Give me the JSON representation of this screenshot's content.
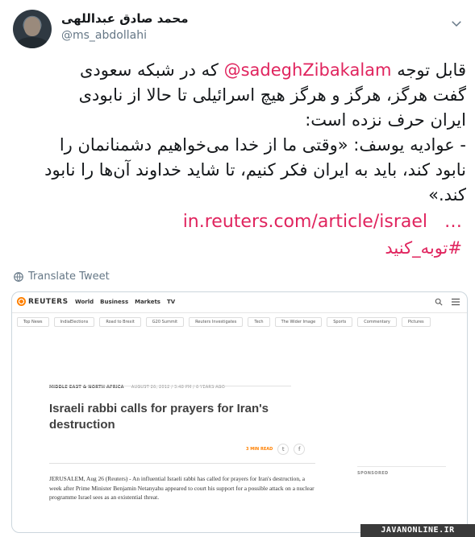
{
  "author": {
    "display_name": "محمد صادق عبداللهی",
    "handle": "@ms_abdollahi"
  },
  "tweet": {
    "line1_before": "قابل توجه ",
    "mention": "@sadeghZibakalam",
    "line1_after": " که در شبکه سعودی",
    "body_rest": "گفت هرگز، هرگز و هرگز هیچ اسرائیلی تا حالا از نابودی\nایران حرف نزده است:\n- عوادیه یوسف: «وقتی ما از خدا می‌خواهیم دشمنانمان را\nنابود کند، باید به ایران فکر کنیم، تا شاید خداوند آن‌ها را نابود\nکند.»",
    "link": "in.reuters.com/article/israel",
    "link_ellipsis": "…",
    "hashtag": "#توبه_کنید"
  },
  "translate_label": "Translate Tweet",
  "card": {
    "logo": "REUTERS",
    "nav": [
      "World",
      "Business",
      "Markets",
      "TV"
    ],
    "sections": [
      "Top News",
      "IndiaElections",
      "Road to Brexit",
      "G20 Summit",
      "Reuters Investigates",
      "Tech",
      "The Wider Image",
      "Sports",
      "Commentary",
      "Pictures"
    ],
    "kicker": "MIDDLE EAST & NORTH AFRICA",
    "date": "AUGUST 26, 2012 / 3:48 PM / 6 YEARS AGO",
    "headline": "Israeli rabbi calls for prayers for Iran's destruction",
    "min_read": "3 MIN READ",
    "share_twitter": "t",
    "share_facebook": "f",
    "body": "JERUSALEM, Aug 26 (Reuters) - An influential Israeli rabbi has called for prayers for Iran's destruction, a week after Prime Minister Benjamin Netanyahu appeared to court his support for a possible attack on a nuclear programme Israel sees as an existential threat.",
    "sponsored": "SPONSORED"
  },
  "watermark": "JAVANONLINE.IR",
  "colors": {
    "accent": "#e0245e",
    "reuters_orange": "#ff8000",
    "muted": "#657786"
  }
}
